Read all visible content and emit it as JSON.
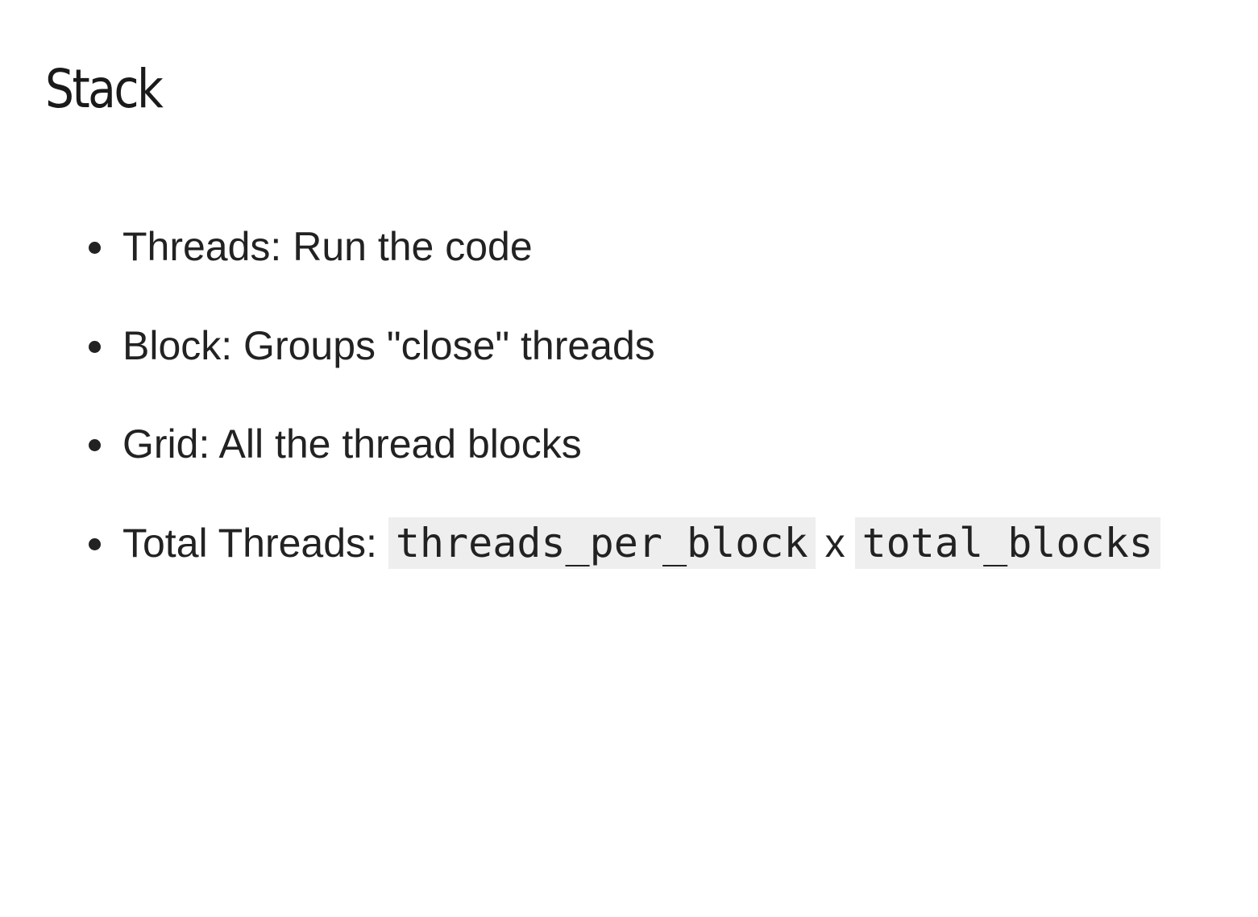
{
  "slide": {
    "title": "Stack",
    "bullets": [
      {
        "text": "Threads: Run the code"
      },
      {
        "text": "Block: Groups \"close\" threads"
      },
      {
        "text": "Grid: All the thread blocks"
      }
    ],
    "total_threads": {
      "label": "Total Threads:",
      "code_left": "threads_per_block",
      "operator": "x",
      "code_right": "total_blocks"
    }
  },
  "colors": {
    "text": "#222222",
    "code_background": "#eeeeee",
    "page_background": "#ffffff"
  }
}
